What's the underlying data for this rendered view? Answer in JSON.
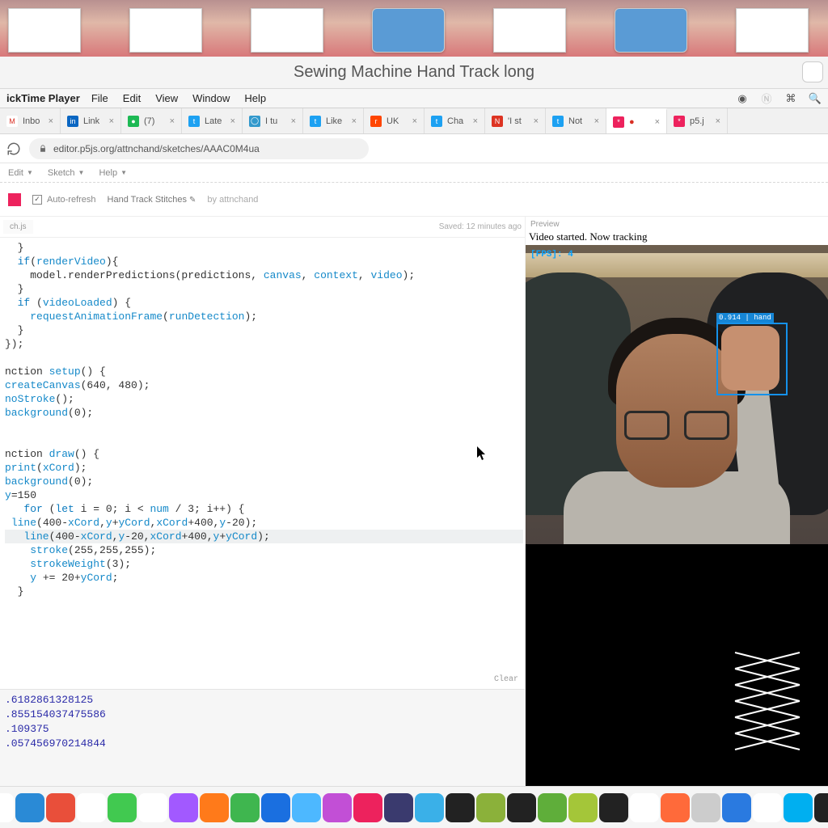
{
  "window_title": "Sewing Machine Hand Track long",
  "mac_menu": {
    "app_name": "ickTime Player",
    "items": [
      "File",
      "Edit",
      "View",
      "Window",
      "Help"
    ]
  },
  "browser": {
    "tabs": [
      {
        "label": "Inbo",
        "favicon_bg": "#fff",
        "favicon_text": "M",
        "favicon_color": "#d93025"
      },
      {
        "label": "Link",
        "favicon_bg": "#0a66c2",
        "favicon_text": "in"
      },
      {
        "label": "(7)",
        "favicon_bg": "#1db954",
        "favicon_text": "●"
      },
      {
        "label": "Late",
        "favicon_bg": "#1da1f2",
        "favicon_text": "t"
      },
      {
        "label": "I tu",
        "favicon_bg": "#39c",
        "favicon_text": "◯"
      },
      {
        "label": "Like",
        "favicon_bg": "#1da1f2",
        "favicon_text": "t"
      },
      {
        "label": "UK",
        "favicon_bg": "#ff4500",
        "favicon_text": "r"
      },
      {
        "label": "Cha",
        "favicon_bg": "#1da1f2",
        "favicon_text": "t"
      },
      {
        "label": "'I st",
        "favicon_bg": "#d32",
        "favicon_text": "N"
      },
      {
        "label": "Not",
        "favicon_bg": "#1da1f2",
        "favicon_text": "t"
      },
      {
        "label": "",
        "favicon_bg": "#ed225d",
        "favicon_text": "*",
        "active": true,
        "rec": true
      },
      {
        "label": "p5.j",
        "favicon_bg": "#ed225d",
        "favicon_text": "*"
      }
    ],
    "url": "editor.p5js.org/attnchand/sketches/AAAC0M4ua"
  },
  "editor_menu": [
    "Edit",
    "Sketch",
    "Help"
  ],
  "project": {
    "auto_refresh_label": "Auto-refresh",
    "title": "Hand Track Stitches",
    "by_label": "by",
    "author": "attnchand"
  },
  "file_tab": "ch.js",
  "saved_text": "Saved: 12 minutes ago",
  "code_lines": [
    {
      "t": "  }"
    },
    {
      "t": "  if(renderVideo){",
      "seg": [
        [
          "  ",
          ""
        ],
        [
          "if",
          "kw"
        ],
        [
          "(",
          ""
        ],
        [
          "renderVideo",
          "var"
        ],
        [
          "){",
          ""
        ]
      ]
    },
    {
      "t": "    model.renderPredictions(predictions, canvas, context, video);",
      "seg": [
        [
          "    model.renderPredictions(predictions, ",
          ""
        ],
        [
          "canvas",
          "var"
        ],
        [
          ", ",
          ""
        ],
        [
          "context",
          "var"
        ],
        [
          ", ",
          ""
        ],
        [
          "video",
          "var"
        ],
        [
          ");",
          ""
        ]
      ]
    },
    {
      "t": "  }"
    },
    {
      "t": "  if (videoLoaded) {",
      "seg": [
        [
          "  ",
          ""
        ],
        [
          "if",
          "kw"
        ],
        [
          " (",
          ""
        ],
        [
          "videoLoaded",
          "var"
        ],
        [
          ") {",
          ""
        ]
      ]
    },
    {
      "t": "    requestAnimationFrame(runDetection);",
      "seg": [
        [
          "    ",
          ""
        ],
        [
          "requestAnimationFrame",
          "fn"
        ],
        [
          "(",
          ""
        ],
        [
          "runDetection",
          "var"
        ],
        [
          ");",
          ""
        ]
      ]
    },
    {
      "t": "  }"
    },
    {
      "t": "});"
    },
    {
      "t": ""
    },
    {
      "t": "nction setup() {",
      "seg": [
        [
          "nction ",
          ""
        ],
        [
          "setup",
          "fn"
        ],
        [
          "() {",
          ""
        ]
      ]
    },
    {
      "t": "createCanvas(640, 480);",
      "seg": [
        [
          "createCanvas",
          "fn"
        ],
        [
          "(640, 480);",
          ""
        ]
      ]
    },
    {
      "t": "noStroke();",
      "seg": [
        [
          "noStroke",
          "fn"
        ],
        [
          "();",
          ""
        ]
      ]
    },
    {
      "t": "background(0);",
      "seg": [
        [
          "background",
          "fn"
        ],
        [
          "(0);",
          ""
        ]
      ]
    },
    {
      "t": ""
    },
    {
      "t": ""
    },
    {
      "t": "nction draw() {",
      "seg": [
        [
          "nction ",
          ""
        ],
        [
          "draw",
          "fn"
        ],
        [
          "() {",
          ""
        ]
      ]
    },
    {
      "t": "print(xCord);",
      "seg": [
        [
          "print",
          "fn"
        ],
        [
          "(",
          ""
        ],
        [
          "xCord",
          "var"
        ],
        [
          ");",
          ""
        ]
      ]
    },
    {
      "t": "background(0);",
      "seg": [
        [
          "background",
          "fn"
        ],
        [
          "(0);",
          ""
        ]
      ]
    },
    {
      "t": "y=150",
      "seg": [
        [
          "y",
          "var"
        ],
        [
          "=150",
          ""
        ]
      ]
    },
    {
      "t": "   for (let i = 0; i < num / 3; i++) {",
      "seg": [
        [
          "   ",
          ""
        ],
        [
          "for",
          "kw"
        ],
        [
          " (",
          ""
        ],
        [
          "let",
          "kw"
        ],
        [
          " i = 0; i < ",
          ""
        ],
        [
          "num",
          "var"
        ],
        [
          " / 3; i++) {",
          ""
        ]
      ]
    },
    {
      "t": " line(400-xCord,y+yCord,xCord+400,y-20);",
      "seg": [
        [
          " ",
          ""
        ],
        [
          "line",
          "fn"
        ],
        [
          "(400-",
          ""
        ],
        [
          "xCord",
          "var"
        ],
        [
          ",",
          ""
        ],
        [
          "y",
          "var"
        ],
        [
          "+",
          ""
        ],
        [
          "yCord",
          "var"
        ],
        [
          ",",
          ""
        ],
        [
          "xCord",
          "var"
        ],
        [
          "+400,",
          ""
        ],
        [
          "y",
          "var"
        ],
        [
          "-20);",
          ""
        ]
      ]
    },
    {
      "t": "   line(400-xCord,y-20,xCord+400,y+yCord);",
      "hl": true,
      "seg": [
        [
          "   ",
          ""
        ],
        [
          "line",
          "fn"
        ],
        [
          "(400-",
          ""
        ],
        [
          "xCord",
          "var"
        ],
        [
          ",",
          ""
        ],
        [
          "y",
          "var"
        ],
        [
          "-20,",
          ""
        ],
        [
          "xCord",
          "var"
        ],
        [
          "+400,",
          ""
        ],
        [
          "y",
          "var"
        ],
        [
          "+",
          ""
        ],
        [
          "yCord",
          "var"
        ],
        [
          ");",
          ""
        ]
      ]
    },
    {
      "t": "    stroke(255,255,255);",
      "seg": [
        [
          "    ",
          ""
        ],
        [
          "stroke",
          "fn"
        ],
        [
          "(255,255,255);",
          ""
        ]
      ]
    },
    {
      "t": "    strokeWeight(3);",
      "seg": [
        [
          "    ",
          ""
        ],
        [
          "strokeWeight",
          "fn"
        ],
        [
          "(3);",
          ""
        ]
      ]
    },
    {
      "t": "    y += 20+yCord;",
      "seg": [
        [
          "    ",
          ""
        ],
        [
          "y",
          "var"
        ],
        [
          " += 20+",
          ""
        ],
        [
          "yCord",
          "var"
        ],
        [
          ";",
          ""
        ]
      ]
    },
    {
      "t": "  }"
    }
  ],
  "console": {
    "clear_label": "Clear",
    "lines": [
      ".6182861328125",
      ".855154037475586",
      ".109375",
      ".057456970214844"
    ]
  },
  "preview": {
    "label": "Preview",
    "status": "Video started. Now tracking",
    "fps_label": "[FPS]: 4",
    "detection_label": "0.914 | hand"
  },
  "dock_colors": [
    "#2a6fd6",
    "#8b8b8b",
    "#7b4fd6",
    "#fff",
    "#2a8ad6",
    "#e94f3a",
    "#fff",
    "#41c950",
    "#fff",
    "#a259ff",
    "#ff7a1a",
    "#3fb64f",
    "#1a6fe0",
    "#4db8ff",
    "#c24fd6",
    "#ed225d",
    "#3a3a6e",
    "#3ab0e8",
    "#222",
    "#8bb13a",
    "#222",
    "#5fae3a",
    "#a4c639",
    "#222",
    "#fff",
    "#ff6a3a",
    "#ccc",
    "#2a7ae0",
    "#fff",
    "#00aff0",
    "#222",
    "#ffb03a",
    "#e84fb0",
    "#ccc"
  ]
}
